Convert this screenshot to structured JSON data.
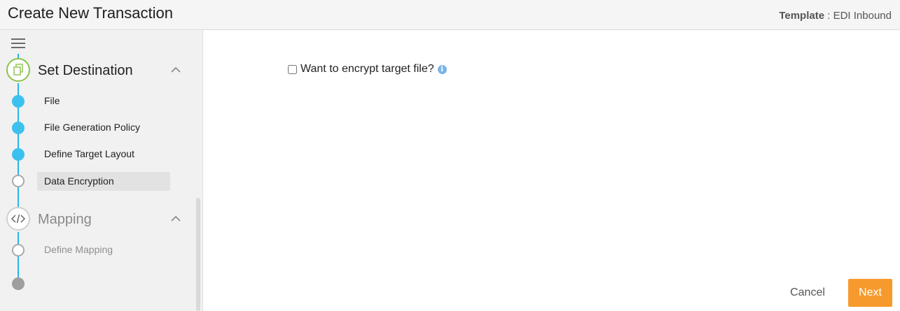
{
  "header": {
    "title": "Create New Transaction",
    "template_label": "Template",
    "template_separator": " : ",
    "template_value": "EDI Inbound"
  },
  "sidebar": {
    "sections": [
      {
        "title": "Set Destination",
        "icon": "document-copy-icon",
        "steps": [
          {
            "label": "File",
            "status": "done"
          },
          {
            "label": "File Generation Policy",
            "status": "done"
          },
          {
            "label": "Define Target Layout",
            "status": "done"
          },
          {
            "label": "Data Encryption",
            "status": "active"
          }
        ]
      },
      {
        "title": "Mapping",
        "icon": "code-icon",
        "steps": [
          {
            "label": "Define Mapping",
            "status": "pending"
          }
        ]
      }
    ]
  },
  "main": {
    "encrypt_label": "Want to encrypt target file?",
    "encrypt_checked": false
  },
  "footer": {
    "cancel_label": "Cancel",
    "next_label": "Next"
  },
  "colors": {
    "accent": "#3cc1ee",
    "primary_button": "#f79a2e",
    "section_complete_ring": "#8bc34a"
  }
}
